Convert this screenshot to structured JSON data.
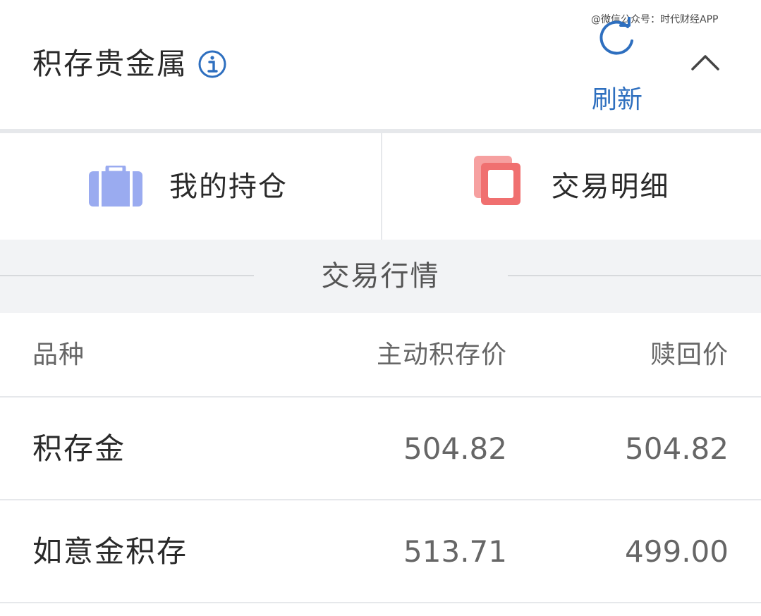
{
  "watermark": "@微信公众号：时代财经APP",
  "header": {
    "title": "积存贵金属",
    "refresh_label": "刷新"
  },
  "actions": [
    {
      "label": "我的持仓",
      "icon": "briefcase-icon",
      "color": "#9aabf0"
    },
    {
      "label": "交易明细",
      "icon": "copy-docs-icon",
      "color": "#f07070"
    }
  ],
  "section": {
    "title": "交易行情"
  },
  "table": {
    "columns": [
      "品种",
      "主动积存价",
      "赎回价"
    ],
    "rows": [
      {
        "name": "积存金",
        "active_price": "504.82",
        "redeem_price": "504.82"
      },
      {
        "name": "如意金积存",
        "active_price": "513.71",
        "redeem_price": "499.00"
      }
    ]
  },
  "colors": {
    "accent": "#2e6fbf",
    "separator": "#e6e8eb",
    "section_bg": "#f2f3f5"
  }
}
